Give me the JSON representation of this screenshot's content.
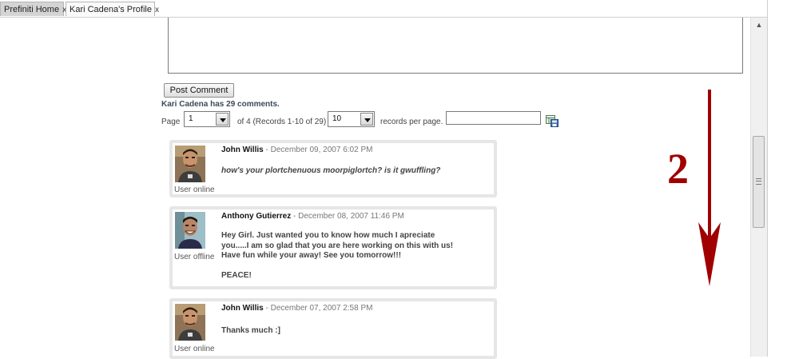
{
  "tabs": [
    {
      "label": "Prefiniti Home",
      "close": "x"
    },
    {
      "label": "Kari Cadena's Profile",
      "close": "x"
    }
  ],
  "post_button": "Post Comment",
  "comment_count": "Kari Cadena has 29 comments.",
  "pager": {
    "page_label": "Page",
    "page_value": "1",
    "of_text": "of 4 (Records 1-10 of 29)",
    "per_page_value": "10",
    "per_page_label": "records per page.",
    "search_value": ""
  },
  "comments": [
    {
      "author": "John Willis",
      "date": "- December 09, 2007 6:02 PM",
      "status": "User online",
      "lines": [
        "how's your plortchenuous moorpiglortch? is it gwuffling?"
      ]
    },
    {
      "author": "Anthony Gutierrez",
      "date": "- December 08, 2007 11:46 PM",
      "status": "User offline",
      "lines": [
        "Hey Girl.  Just wanted you to know how much I apreciate",
        "you.....I am so glad that you are here working on this with us!",
        "Have fun while your away!  See you tomorrow!!!",
        "",
        "PEACE!"
      ]
    },
    {
      "author": "John Willis",
      "date": "- December 07, 2007 2:58 PM",
      "status": "User online",
      "lines": [
        "Thanks much :]"
      ]
    }
  ],
  "annotation": {
    "number": "2",
    "color": "#a00000"
  },
  "icons": {
    "export": "export-icon",
    "close": "close-icon"
  }
}
